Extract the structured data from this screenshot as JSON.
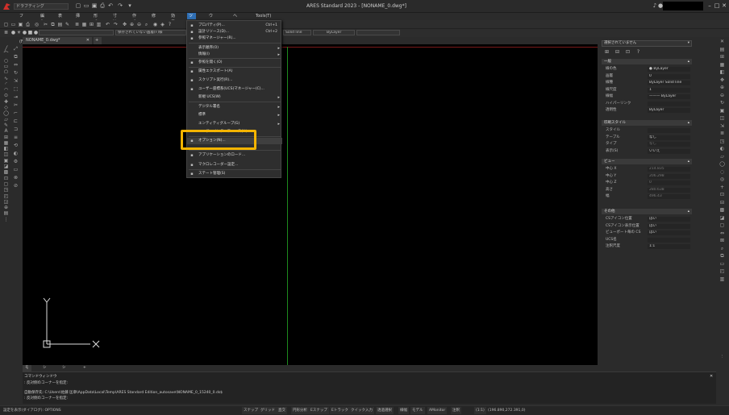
{
  "titlebar": {
    "workspace": "ドラフティング",
    "title": "ARES Standard 2023 - [NONAME_0.dwg*]"
  },
  "menubar": [
    {
      "label": "ファイル(F)"
    },
    {
      "label": "編集(E)"
    },
    {
      "label": "表示(V)"
    },
    {
      "label": "挿入(I)"
    },
    {
      "label": "形式(O)"
    },
    {
      "label": "寸法(N)"
    },
    {
      "label": "作成(D)"
    },
    {
      "label": "修正(M)"
    },
    {
      "label": "効果(E)"
    },
    {
      "label": "ツール(T)"
    },
    {
      "label": "ウィンドウ(W)"
    },
    {
      "label": "ヘルプ(H)"
    },
    {
      "label": "Tools(T)"
    }
  ],
  "toolbar": {
    "layer_combo": "保存されていない画層(F)様",
    "linetype_combo": "Solid line",
    "lineweight_combo": "ByLayer",
    "layer_state": "",
    "extra_combo": ""
  },
  "doc_tab": "NONAME_0.dwg*",
  "tools_menu": {
    "items": [
      {
        "icon": "properties-icon",
        "label": "プロパティ(P)...",
        "shortcut": "Ctrl+1",
        "arrow": ""
      },
      {
        "icon": "design-resources-icon",
        "label": "設計リソース(D)...",
        "shortcut": "Ctrl+2",
        "arrow": ""
      },
      {
        "icon": "reference-manager-icon",
        "label": "参照マネージャー(R)...",
        "shortcut": "",
        "arrow": ""
      },
      {
        "icon": "",
        "label": "表示順序(O)",
        "shortcut": "",
        "arrow": "▸"
      },
      {
        "icon": "",
        "label": "情報(I)",
        "shortcut": "",
        "arrow": "▸"
      },
      {
        "icon": "load-reference-icon",
        "label": "参照を開く(O)",
        "shortcut": "",
        "arrow": ""
      },
      {
        "icon": "attribute-export-icon",
        "label": "属性エクスポート(A)",
        "shortcut": "",
        "arrow": ""
      },
      {
        "icon": "script-icon",
        "label": "スクリプト実行(R)...",
        "shortcut": "",
        "arrow": ""
      },
      {
        "icon": "ucs-icon",
        "label": "ユーザー座標系(UCS)マネージャー(C)...",
        "shortcut": "",
        "arrow": ""
      },
      {
        "icon": "",
        "label": "新規 UCS(W)",
        "shortcut": "",
        "arrow": "▸"
      },
      {
        "icon": "",
        "label": "デジタル署名",
        "shortcut": "",
        "arrow": "▸"
      },
      {
        "icon": "",
        "label": "標準",
        "shortcut": "",
        "arrow": "▸"
      },
      {
        "icon": "",
        "label": "エンティティグループ(G)",
        "shortcut": "",
        "arrow": "▸"
      },
      {
        "icon": "",
        "label": "ユーザーインターフェース(U)...",
        "shortcut": "",
        "arrow": ""
      },
      {
        "icon": "options-icon",
        "label": "オプション(N)...",
        "shortcut": "",
        "arrow": ""
      },
      {
        "icon": "app-load-icon",
        "label": "アプリケーションのロード...",
        "shortcut": "",
        "arrow": ""
      },
      {
        "icon": "macro-recorder-icon",
        "label": "マクロレコーダー設定...",
        "shortcut": "",
        "arrow": ""
      },
      {
        "icon": "state-manager-icon",
        "label": "ステート管理(S)",
        "shortcut": "",
        "arrow": ""
      }
    ]
  },
  "properties": {
    "selector": "選択されていません",
    "sections": [
      {
        "title": "一般",
        "rows": [
          {
            "key": "線の色",
            "value": "● ByLayer",
            "dim": false
          },
          {
            "key": "画層",
            "value": "0",
            "dim": false
          },
          {
            "key": "線種",
            "value": "ByLayer   Solid line",
            "dim": false
          },
          {
            "key": "線尺度",
            "value": "1",
            "dim": false
          },
          {
            "key": "線幅",
            "value": "——— ByLayer",
            "dim": false
          },
          {
            "key": "ハイパーリンク",
            "value": "",
            "dim": false
          },
          {
            "key": "透明性",
            "value": "ByLayer",
            "dim": false
          }
        ]
      },
      {
        "title": "印刷スタイル",
        "rows": [
          {
            "key": "スタイル",
            "value": "",
            "dim": false
          },
          {
            "key": "テーブル",
            "value": "なし",
            "dim": false
          },
          {
            "key": "タイプ",
            "value": "なし",
            "dim": true
          },
          {
            "key": "表示(S)",
            "value": "いいえ",
            "dim": false
          }
        ]
      },
      {
        "title": "ビュー",
        "rows": [
          {
            "key": "中心 X",
            "value": "214.835",
            "dim": true
          },
          {
            "key": "中心 Y",
            "value": "206.298",
            "dim": true
          },
          {
            "key": "中心 Z",
            "value": "0",
            "dim": true
          },
          {
            "key": "高さ",
            "value": "280.638",
            "dim": true
          },
          {
            "key": "幅",
            "value": "496.43",
            "dim": true
          }
        ]
      },
      {
        "title": "その他",
        "rows": [
          {
            "key": "CSアイコン位置",
            "value": "はい",
            "dim": false
          },
          {
            "key": "CSアイコン表示位置",
            "value": "はい",
            "dim": false
          },
          {
            "key": "ビューポート毎の CS",
            "value": "はい",
            "dim": false
          },
          {
            "key": "UCS名",
            "value": "",
            "dim": false
          },
          {
            "key": "注釈尺度",
            "value": "1:1",
            "dim": false
          }
        ]
      }
    ]
  },
  "layout_tabs": [
    "モデル",
    "シート1",
    "シート2",
    "+"
  ],
  "command_window": {
    "title": "コマンドウィンドウ",
    "lines": [
      ": 反対側のコーナーを指定:",
      "自動保存先: C:\\Users\\佐藤 匡章\\AppData\\Local\\Temp\\ARES Standard Edition_autosave\\NONAME_0_15240_0.ds$",
      ": 反対側のコーナーを指定:"
    ]
  },
  "status_bar": {
    "left_text": "設定を表示(ダイアログ): OPTIONS",
    "buttons": [
      "スナップ",
      "グリッド",
      "直交",
      "円形分析",
      "Eスナップ",
      "Eトラック",
      "クイック入力",
      "透過選択",
      "線幅",
      "モデル",
      "AMonitor",
      "注釈"
    ],
    "scale": "(1:1)",
    "coords": "(196.890,272.391,0)"
  },
  "colors": {
    "canvas": "#000000",
    "menu_active": "#2f6fb4",
    "highlight": "#f4b400",
    "y_axis_line": "#1e8a1e",
    "x_axis_line": "#7a1a1a"
  }
}
